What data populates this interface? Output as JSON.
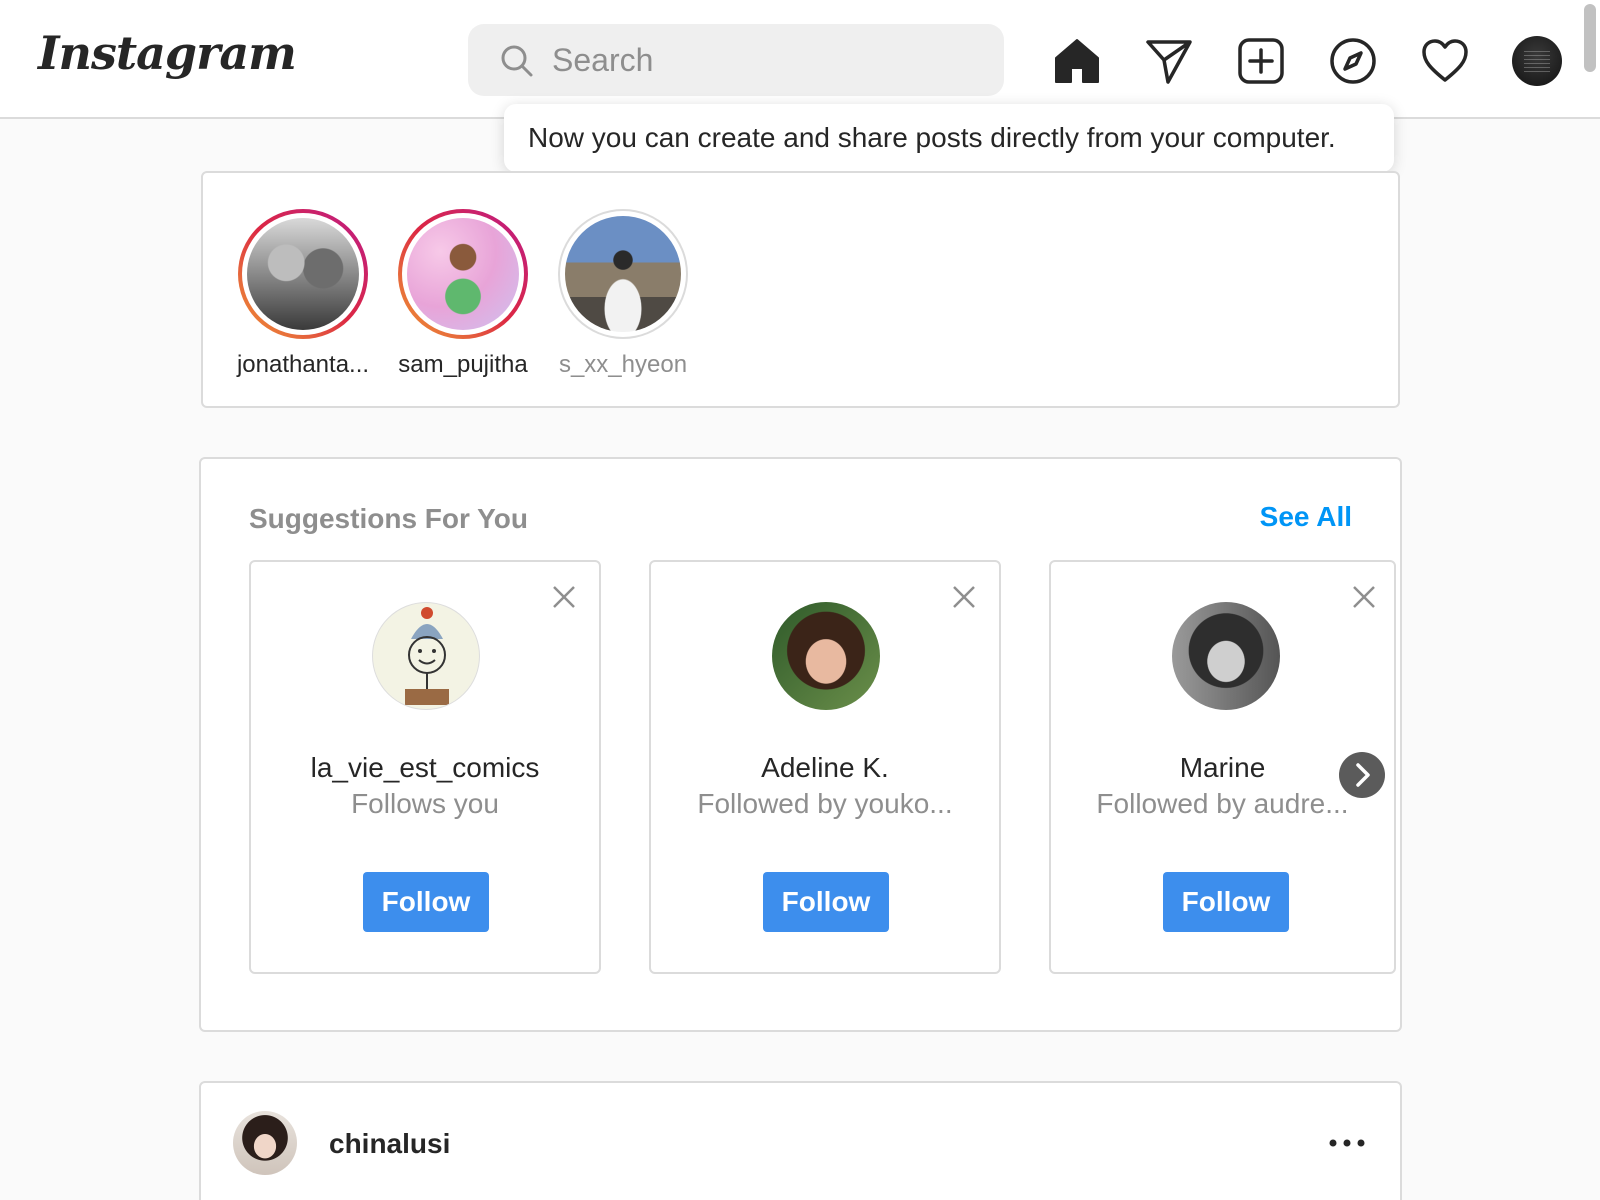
{
  "header": {
    "logo_text": "Instagram",
    "search_placeholder": "Search",
    "nav_icons": [
      "home-icon",
      "direct-message-icon",
      "new-post-icon",
      "explore-icon",
      "activity-heart-icon",
      "profile-avatar"
    ]
  },
  "tooltip": {
    "text": "Now you can create and share posts directly from your computer."
  },
  "stories": [
    {
      "username": "jonathanta...",
      "seen": false
    },
    {
      "username": "sam_pujitha",
      "seen": false
    },
    {
      "username": "s_xx_hyeon",
      "seen": true
    }
  ],
  "suggestions": {
    "title": "Suggestions For You",
    "see_all": "See All",
    "cards": [
      {
        "name": "la_vie_est_comics",
        "subtitle": "Follows you",
        "follow_label": "Follow"
      },
      {
        "name": "Adeline K.",
        "subtitle": "Followed by youko...",
        "follow_label": "Follow"
      },
      {
        "name": "Marine",
        "subtitle": "Followed by audre...",
        "follow_label": "Follow"
      }
    ]
  },
  "post": {
    "username": "chinalusi"
  },
  "colors": {
    "accent": "#0095f6",
    "follow_button": "#3d8eed",
    "border": "#dbdbdb",
    "background": "#fafafa"
  }
}
